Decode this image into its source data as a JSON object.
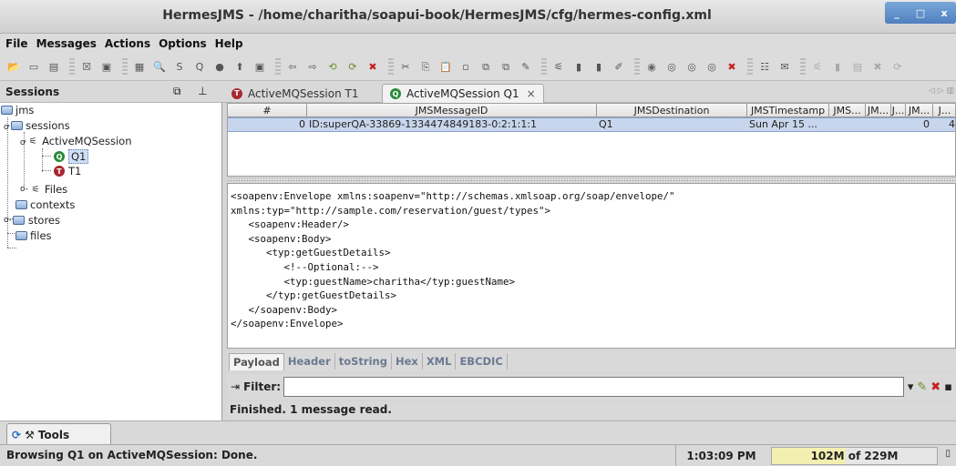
{
  "window": {
    "title": "HermesJMS - /home/charitha/soapui-book/HermesJMS/cfg/hermes-config.xml",
    "controls": [
      "_",
      "□",
      "x"
    ]
  },
  "menu": [
    "File",
    "Messages",
    "Actions",
    "Options",
    "Help"
  ],
  "toolbar_icons": [
    "open-icon",
    "save-icon",
    "print-icon",
    "sep",
    "clear-icon",
    "browse-icon",
    "sep",
    "queue-icon",
    "search-icon",
    "sql-icon",
    "query-icon",
    "connect-icon",
    "topic-icon",
    "topic-browse-icon",
    "sep",
    "back-icon",
    "forward-icon",
    "refresh-icon",
    "refresh-all-icon",
    "delete-icon",
    "sep",
    "cut-icon",
    "copy-icon",
    "paste-icon",
    "new-icon",
    "copy-message-icon",
    "move-message-icon",
    "edit-icon",
    "sep",
    "session-icon",
    "queue-add-icon",
    "topic-add-icon",
    "edit-session-icon",
    "sep",
    "run-icon",
    "watch-icon",
    "stop-icon",
    "stop-all-icon",
    "cancel-icon",
    "sep",
    "config-icon",
    "message-icon",
    "sep",
    "disabled1-icon",
    "disabled2-icon",
    "disabled3-icon",
    "disabled4-icon",
    "disabled5-icon"
  ],
  "sessions_panel": {
    "title": "Sessions",
    "tree": [
      {
        "label": "jms",
        "icon": "folder-open-icon",
        "level": 0
      },
      {
        "label": "sessions",
        "icon": "folder-open-icon",
        "level": 1
      },
      {
        "label": "ActiveMQSession",
        "icon": "session-icon",
        "level": 2
      },
      {
        "label": "Q1",
        "icon": "queue-icon",
        "level": 3,
        "selected": true
      },
      {
        "label": "T1",
        "icon": "topic-icon",
        "level": 3
      },
      {
        "label": "Files",
        "icon": "session-icon",
        "level": 2
      },
      {
        "label": "contexts",
        "icon": "folder-icon",
        "level": 1
      },
      {
        "label": "stores",
        "icon": "folder-icon",
        "level": 1
      },
      {
        "label": "files",
        "icon": "folder-icon",
        "level": 1
      }
    ]
  },
  "tabs": [
    {
      "label": "ActiveMQSession T1",
      "active": false
    },
    {
      "label": "ActiveMQSession Q1",
      "active": true,
      "close": "×"
    }
  ],
  "message_table": {
    "columns": [
      "#",
      "JMSMessageID",
      "JMSDestination",
      "JMSTimestamp",
      "JMS...",
      "JM...",
      "J...",
      "JM...",
      "J..."
    ],
    "rows": [
      [
        "0",
        "ID:superQA-33869-1334474849183-0:2:1:1:1",
        "Q1",
        "Sun Apr 15 ...",
        "",
        "",
        "",
        "0",
        "4"
      ]
    ]
  },
  "payload_lines": [
    "<soapenv:Envelope xmlns:soapenv=\"http://schemas.xmlsoap.org/soap/envelope/\"",
    "xmlns:typ=\"http://sample.com/reservation/guest/types\">",
    "   <soapenv:Header/>",
    "   <soapenv:Body>",
    "      <typ:getGuestDetails>",
    "         <!--Optional:-->",
    "         <typ:guestName>charitha</typ:guestName>",
    "      </typ:getGuestDetails>",
    "   </soapenv:Body>",
    "</soapenv:Envelope>"
  ],
  "view_tabs": [
    "Payload",
    "Header",
    "toString",
    "Hex",
    "XML",
    "EBCDIC"
  ],
  "filter": {
    "label": "Filter:",
    "value": ""
  },
  "panel_status": "Finished. 1 message read.",
  "tools_tab": {
    "label": "Tools"
  },
  "status_bar": {
    "message": "Browsing Q1 on ActiveMQSession: Done.",
    "time": "1:03:09 PM",
    "memory_used": "102M",
    "memory_of": "of 229M",
    "memory_fraction": 0.445
  }
}
